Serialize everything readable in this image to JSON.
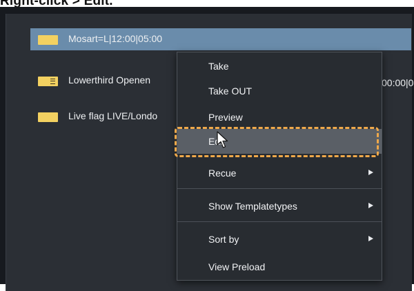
{
  "caption": "Right-click > Edit.",
  "playlist": {
    "items": [
      {
        "label": "Mosart=L|12:00|05:00",
        "selected": true,
        "icon": "yellow-block-icon"
      },
      {
        "label": "Lowerthird Openen",
        "selected": false,
        "icon": "yellow-block-lines-icon",
        "trailing_text": "00:00|0"
      },
      {
        "label": "Live flag LIVE/Londo",
        "selected": false,
        "icon": "yellow-block-icon"
      }
    ]
  },
  "context_menu": {
    "items": [
      {
        "label": "Take"
      },
      {
        "label": "Take OUT"
      },
      {
        "label": "Preview"
      },
      {
        "label": "Edit",
        "hovered": true
      },
      {
        "label": "Recue",
        "submenu": true
      },
      {
        "label": "Show Templatetypes",
        "submenu": true
      },
      {
        "label": "Sort by",
        "submenu": true
      },
      {
        "label": "View Preload"
      }
    ]
  },
  "colors": {
    "selected_row": "#6a8cab",
    "icon_yellow": "#f3d161",
    "highlight_dash": "#f0a94a",
    "menu_background": "#282c31"
  }
}
